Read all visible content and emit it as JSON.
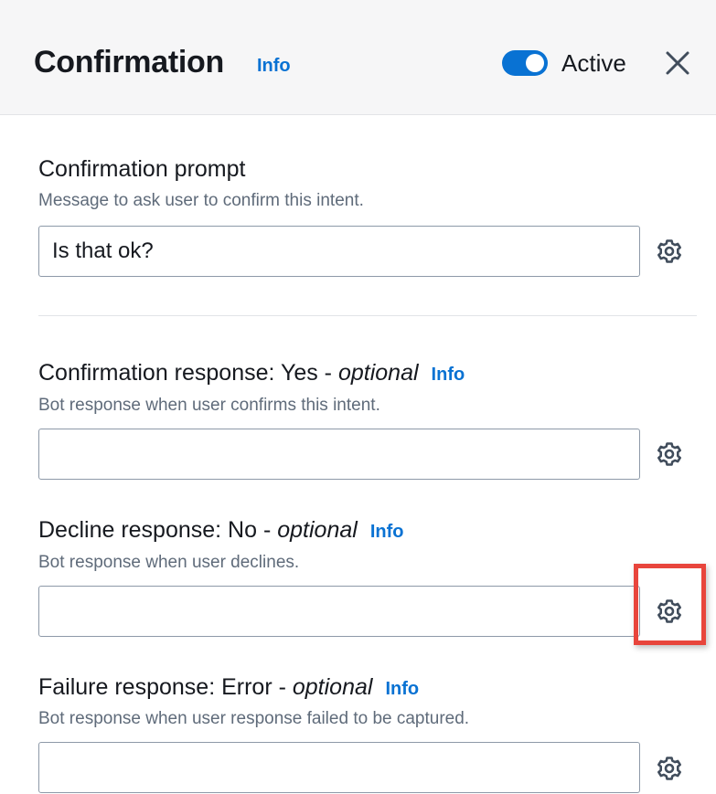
{
  "header": {
    "title": "Confirmation",
    "info_label": "Info",
    "toggle": {
      "label": "Active",
      "state": "on"
    },
    "close_icon": "close-icon"
  },
  "confirmation_prompt": {
    "label": "Confirmation prompt",
    "description": "Message to ask user to confirm this intent.",
    "value": "Is that ok?",
    "settings_icon": "gear-icon"
  },
  "confirmation_response": {
    "label": "Confirmation response: Yes - ",
    "optional": "optional",
    "info_label": "Info",
    "description": "Bot response when user confirms this intent.",
    "value": "",
    "settings_icon": "gear-icon"
  },
  "decline_response": {
    "label": "Decline response: No - ",
    "optional": "optional",
    "info_label": "Info",
    "description": "Bot response when user declines.",
    "value": "",
    "settings_icon": "gear-icon",
    "highlighted": true
  },
  "failure_response": {
    "label": "Failure response: Error - ",
    "optional": "optional",
    "info_label": "Info",
    "description": "Bot response when user response failed to be captured.",
    "value": "",
    "settings_icon": "gear-icon"
  },
  "colors": {
    "accent": "#0972d3",
    "highlight": "#e8453c",
    "header_bg": "#f6f6f7"
  }
}
